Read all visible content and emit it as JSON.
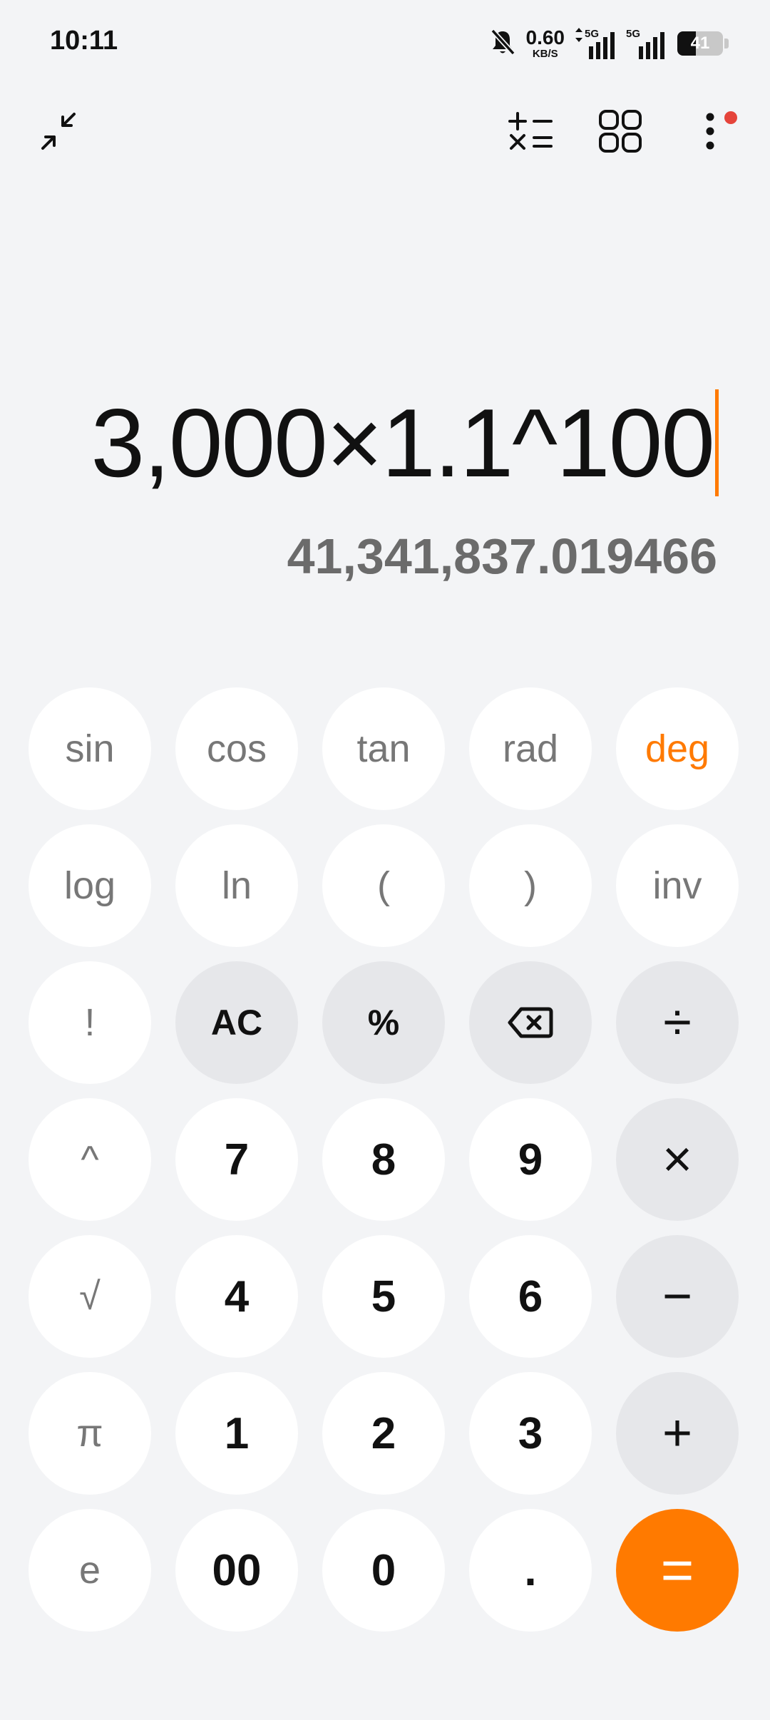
{
  "status_bar": {
    "time": "10:11",
    "net_speed_value": "0.60",
    "net_speed_unit": "KB/S",
    "sim1_label": "5G",
    "sim2_label": "5G",
    "battery_level": "41",
    "battery_fraction": 0.41,
    "icons": [
      "bell-muted-icon",
      "data-arrows-icon",
      "signal-icon",
      "signal-icon",
      "battery-icon"
    ]
  },
  "toolbar": {
    "icons": [
      "collapse-icon",
      "converter-icon",
      "apps-grid-icon",
      "more-vert-icon"
    ],
    "more_has_notification": true
  },
  "display": {
    "expression": "3,000×1.1^100",
    "result": "41,341,837.019466"
  },
  "keypad": {
    "rows": [
      [
        {
          "label": "sin",
          "name": "key-sin"
        },
        {
          "label": "cos",
          "name": "key-cos"
        },
        {
          "label": "tan",
          "name": "key-tan"
        },
        {
          "label": "rad",
          "name": "key-rad"
        },
        {
          "label": "deg",
          "name": "key-deg",
          "active": true
        }
      ],
      [
        {
          "label": "log",
          "name": "key-log"
        },
        {
          "label": "ln",
          "name": "key-ln"
        },
        {
          "label": "(",
          "name": "key-open-paren"
        },
        {
          "label": ")",
          "name": "key-close-paren"
        },
        {
          "label": "inv",
          "name": "key-inv"
        }
      ],
      [
        {
          "label": "!",
          "name": "key-factorial"
        },
        {
          "label": "AC",
          "name": "key-clear",
          "style": "grey-bold"
        },
        {
          "label": "%",
          "name": "key-percent",
          "style": "grey-bold"
        },
        {
          "icon": "backspace-icon",
          "name": "key-backspace",
          "style": "grey-bold"
        },
        {
          "label": "÷",
          "name": "key-divide",
          "style": "op"
        }
      ],
      [
        {
          "label": "^",
          "name": "key-power"
        },
        {
          "label": "7",
          "name": "key-7",
          "style": "digit"
        },
        {
          "label": "8",
          "name": "key-8",
          "style": "digit"
        },
        {
          "label": "9",
          "name": "key-9",
          "style": "digit"
        },
        {
          "label": "×",
          "name": "key-multiply",
          "style": "op"
        }
      ],
      [
        {
          "label": "√",
          "name": "key-sqrt"
        },
        {
          "label": "4",
          "name": "key-4",
          "style": "digit"
        },
        {
          "label": "5",
          "name": "key-5",
          "style": "digit"
        },
        {
          "label": "6",
          "name": "key-6",
          "style": "digit"
        },
        {
          "label": "−",
          "name": "key-subtract",
          "style": "op"
        }
      ],
      [
        {
          "label": "π",
          "name": "key-pi"
        },
        {
          "label": "1",
          "name": "key-1",
          "style": "digit"
        },
        {
          "label": "2",
          "name": "key-2",
          "style": "digit"
        },
        {
          "label": "3",
          "name": "key-3",
          "style": "digit"
        },
        {
          "label": "+",
          "name": "key-add",
          "style": "op"
        }
      ],
      [
        {
          "label": "e",
          "name": "key-e"
        },
        {
          "label": "00",
          "name": "key-00",
          "style": "digit"
        },
        {
          "label": "0",
          "name": "key-0",
          "style": "digit"
        },
        {
          "label": ".",
          "name": "key-decimal",
          "style": "digit"
        },
        {
          "label": "=",
          "name": "key-equals",
          "style": "equals"
        }
      ]
    ]
  },
  "colors": {
    "background": "#f3f4f6",
    "accent": "#ff7a00",
    "key_white": "#ffffff",
    "key_grey": "#e6e7ea",
    "notification": "#e5443b",
    "result_text": "#6b6b6b"
  }
}
